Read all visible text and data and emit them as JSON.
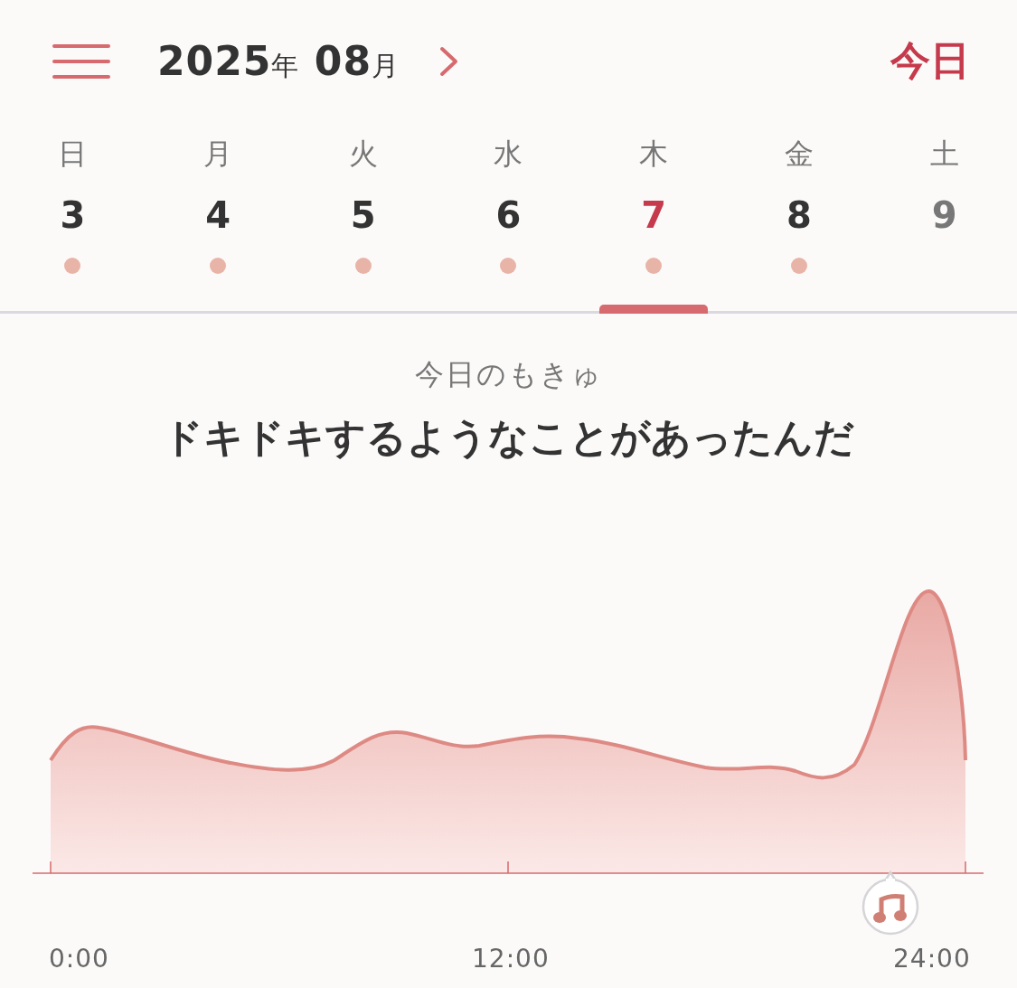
{
  "header": {
    "year": "2025",
    "year_unit": "年",
    "month": "08",
    "month_unit": "月",
    "today_button": "今日"
  },
  "days": [
    {
      "weekday": "日",
      "date": "3",
      "has_entry": true,
      "selected": false,
      "disabled": false
    },
    {
      "weekday": "月",
      "date": "4",
      "has_entry": true,
      "selected": false,
      "disabled": false
    },
    {
      "weekday": "火",
      "date": "5",
      "has_entry": true,
      "selected": false,
      "disabled": false
    },
    {
      "weekday": "水",
      "date": "6",
      "has_entry": true,
      "selected": false,
      "disabled": false
    },
    {
      "weekday": "木",
      "date": "7",
      "has_entry": true,
      "selected": true,
      "disabled": false
    },
    {
      "weekday": "金",
      "date": "8",
      "has_entry": true,
      "selected": false,
      "disabled": false
    },
    {
      "weekday": "土",
      "date": "9",
      "has_entry": false,
      "selected": false,
      "disabled": true
    }
  ],
  "summary": {
    "caption": "今日のもきゅ",
    "message": "ドキドキするようなことがあったんだ"
  },
  "chart": {
    "x_labels": [
      "0:00",
      "12:00",
      "24:00"
    ],
    "markers": [
      {
        "kind": "music"
      }
    ]
  }
}
